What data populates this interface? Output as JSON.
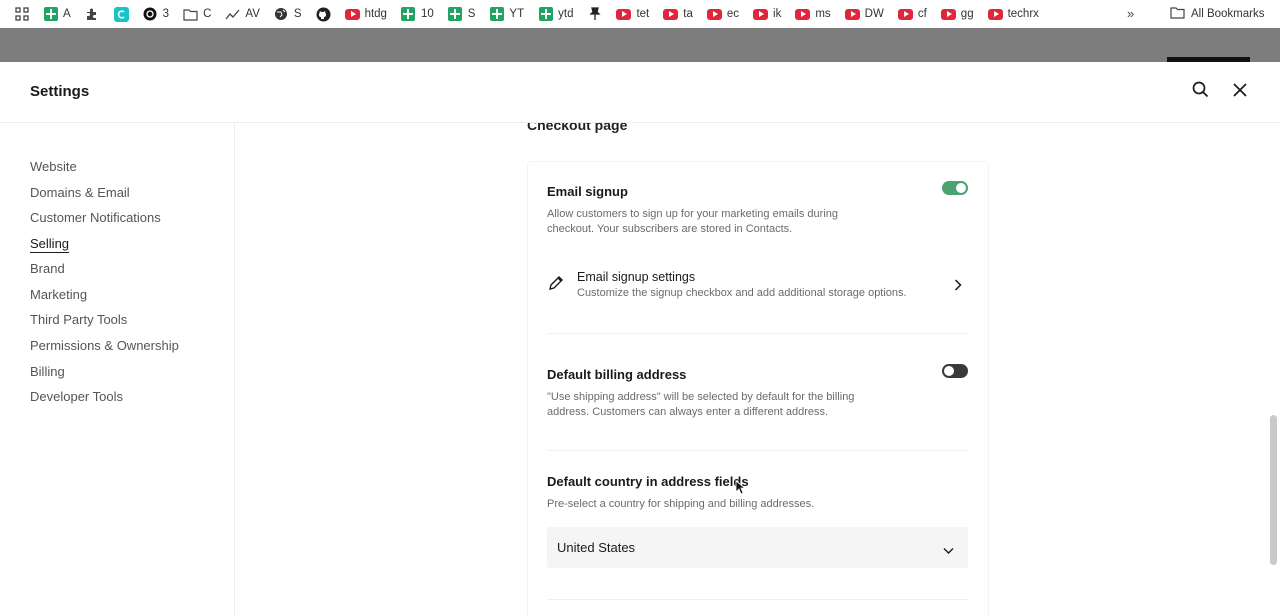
{
  "bookmarks": {
    "items": [
      {
        "label": "",
        "icon": "apps-grid-icon"
      },
      {
        "label": "A",
        "icon": "sheets-icon"
      },
      {
        "label": "",
        "icon": "extension-icon"
      },
      {
        "label": "",
        "icon": "canva-icon"
      },
      {
        "label": "3",
        "icon": "threads-icon"
      },
      {
        "label": "C",
        "icon": "folder-icon"
      },
      {
        "label": "AV",
        "icon": "trend-icon"
      },
      {
        "label": "S",
        "icon": "globe-icon"
      },
      {
        "label": "",
        "icon": "github-icon"
      },
      {
        "label": "htdg",
        "icon": "youtube-icon"
      },
      {
        "label": "10",
        "icon": "sheets-icon"
      },
      {
        "label": "S",
        "icon": "sheets-icon"
      },
      {
        "label": "YT",
        "icon": "sheets-icon"
      },
      {
        "label": "ytd",
        "icon": "sheets-icon"
      },
      {
        "label": "",
        "icon": "pin-icon"
      },
      {
        "label": "tet",
        "icon": "youtube-icon"
      },
      {
        "label": "ta",
        "icon": "youtube-icon"
      },
      {
        "label": "ec",
        "icon": "youtube-icon"
      },
      {
        "label": "ik",
        "icon": "youtube-icon"
      },
      {
        "label": "ms",
        "icon": "youtube-icon"
      },
      {
        "label": "DW",
        "icon": "youtube-icon"
      },
      {
        "label": "cf",
        "icon": "youtube-icon"
      },
      {
        "label": "gg",
        "icon": "youtube-icon"
      },
      {
        "label": "techrx",
        "icon": "youtube-icon"
      }
    ],
    "overflow": "»",
    "all_bookmarks": "All Bookmarks"
  },
  "settings": {
    "title": "Settings",
    "nav": [
      {
        "label": "Website",
        "active": false
      },
      {
        "label": "Domains & Email",
        "active": false
      },
      {
        "label": "Customer Notifications",
        "active": false
      },
      {
        "label": "Selling",
        "active": true
      },
      {
        "label": "Brand",
        "active": false
      },
      {
        "label": "Marketing",
        "active": false
      },
      {
        "label": "Third Party Tools",
        "active": false
      },
      {
        "label": "Permissions & Ownership",
        "active": false
      },
      {
        "label": "Billing",
        "active": false
      },
      {
        "label": "Developer Tools",
        "active": false
      }
    ]
  },
  "checkout": {
    "heading": "Checkout page",
    "email_signup": {
      "title": "Email signup",
      "description": "Allow customers to sign up for your marketing emails during checkout. Your subscribers are stored in Contacts.",
      "enabled": true
    },
    "email_signup_settings": {
      "title": "Email signup settings",
      "description": "Customize the signup checkbox and add additional storage options."
    },
    "default_billing": {
      "title": "Default billing address",
      "description": "\"Use shipping address\" will be selected by default for the billing address. Customers can always enter a different address.",
      "enabled": false
    },
    "default_country": {
      "title": "Default country in address fields",
      "description": "Pre-select a country for shipping and billing addresses.",
      "selected": "United States"
    }
  },
  "colors": {
    "toggle_on": "#4aa46f",
    "toggle_off": "#3a3a3a",
    "youtube": "#e0263b",
    "sheets": "#1fa463"
  }
}
